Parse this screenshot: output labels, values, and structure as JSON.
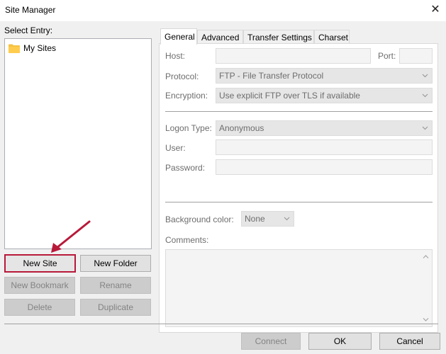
{
  "window": {
    "title": "Site Manager",
    "close_glyph": "✕"
  },
  "tree": {
    "label": "Select Entry:",
    "items": [
      {
        "label": "My Sites",
        "icon": "folder-icon"
      }
    ]
  },
  "left_buttons": {
    "new_site": "New Site",
    "new_folder": "New Folder",
    "new_bookmark": "New Bookmark",
    "rename": "Rename",
    "delete": "Delete",
    "duplicate": "Duplicate"
  },
  "tabs": [
    "General",
    "Advanced",
    "Transfer Settings",
    "Charset"
  ],
  "general": {
    "host_label": "Host:",
    "host_value": "",
    "port_label": "Port:",
    "port_value": "",
    "protocol_label": "Protocol:",
    "protocol_value": "FTP - File Transfer Protocol",
    "encryption_label": "Encryption:",
    "encryption_value": "Use explicit FTP over TLS if available",
    "logon_label": "Logon Type:",
    "logon_value": "Anonymous",
    "user_label": "User:",
    "user_value": "",
    "password_label": "Password:",
    "password_value": "",
    "bg_label": "Background color:",
    "bg_value": "None",
    "comments_label": "Comments:",
    "comments_value": ""
  },
  "footer": {
    "connect": "Connect",
    "ok": "OK",
    "cancel": "Cancel"
  },
  "colors": {
    "highlight": "#b8193a",
    "folder": "#f5c242"
  }
}
